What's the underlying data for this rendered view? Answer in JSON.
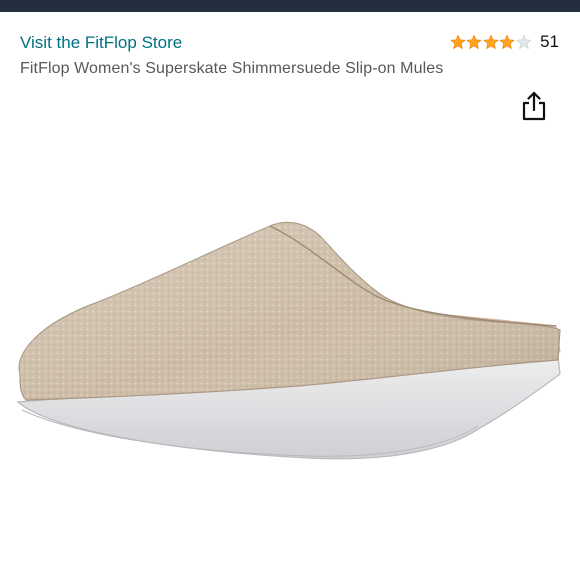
{
  "header": {
    "store_link": "Visit the FitFlop Store",
    "rating": {
      "stars": 4,
      "max_stars": 5,
      "count": "51"
    },
    "product_title": "FitFlop Women's Superskate Shimmersuede Slip-on Mules"
  },
  "colors": {
    "topbar": "#232f3e",
    "link": "#007185",
    "star_filled": "#ffa41c",
    "star_empty": "#d5d9d9",
    "title_text": "#565959"
  },
  "icons": {
    "share": "share-icon",
    "star": "star-icon"
  }
}
